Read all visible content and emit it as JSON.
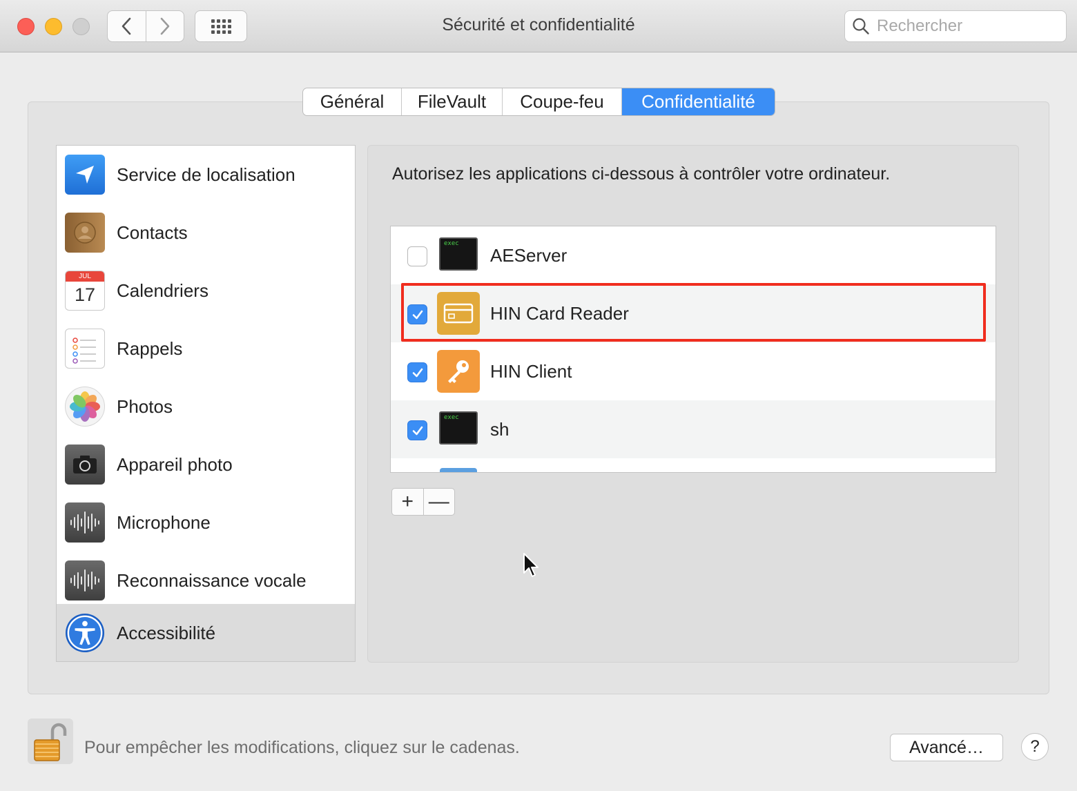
{
  "window": {
    "title": "Sécurité et confidentialité",
    "back_icon": "chevron-left-icon",
    "forward_icon": "chevron-right-icon",
    "grid_icon": "show-all-grid-icon"
  },
  "search": {
    "placeholder": "Rechercher",
    "value": ""
  },
  "tabs": [
    {
      "label": "Général",
      "active": false
    },
    {
      "label": "FileVault",
      "active": false
    },
    {
      "label": "Coupe-feu",
      "active": false
    },
    {
      "label": "Confidentialité",
      "active": true
    }
  ],
  "sidebar": {
    "items": [
      {
        "label": "Service de localisation",
        "icon": "location-arrow-icon",
        "selected": false
      },
      {
        "label": "Contacts",
        "icon": "contacts-book-icon",
        "selected": false
      },
      {
        "label": "Calendriers",
        "icon": "calendar-icon",
        "icon_month": "JUL",
        "icon_day": "17",
        "selected": false
      },
      {
        "label": "Rappels",
        "icon": "reminders-list-icon",
        "selected": false
      },
      {
        "label": "Photos",
        "icon": "photos-flower-icon",
        "selected": false
      },
      {
        "label": "Appareil photo",
        "icon": "camera-icon",
        "selected": false
      },
      {
        "label": "Microphone",
        "icon": "microphone-waveform-icon",
        "selected": false
      },
      {
        "label": "Reconnaissance vocale",
        "icon": "speech-waveform-icon",
        "selected": false
      },
      {
        "label": "Accessibilité",
        "icon": "accessibility-icon",
        "selected": true
      }
    ]
  },
  "main": {
    "description": "Autorisez les applications ci-dessous à contrôler votre ordinateur.",
    "apps": [
      {
        "label": "AEServer",
        "checked": false,
        "icon": "exec-terminal-icon",
        "icon_text": "exec"
      },
      {
        "label": "HIN Card Reader",
        "checked": true,
        "icon": "card-reader-icon",
        "highlighted": true
      },
      {
        "label": "HIN Client",
        "checked": true,
        "icon": "key-icon"
      },
      {
        "label": "sh",
        "checked": true,
        "icon": "exec-terminal-icon",
        "icon_text": "exec"
      }
    ],
    "add_label": "+",
    "remove_label": "—"
  },
  "footer": {
    "lock_icon": "unlocked-padlock-icon",
    "lock_text": "Pour empêcher les modifications, cliquez sur le cadenas.",
    "advanced_label": "Avancé…",
    "help_label": "?"
  },
  "colors": {
    "accent": "#3b8ef5",
    "highlight_box": "#f02d1e",
    "card_reader": "#e2a93a",
    "hin_client": "#f39a3c"
  }
}
